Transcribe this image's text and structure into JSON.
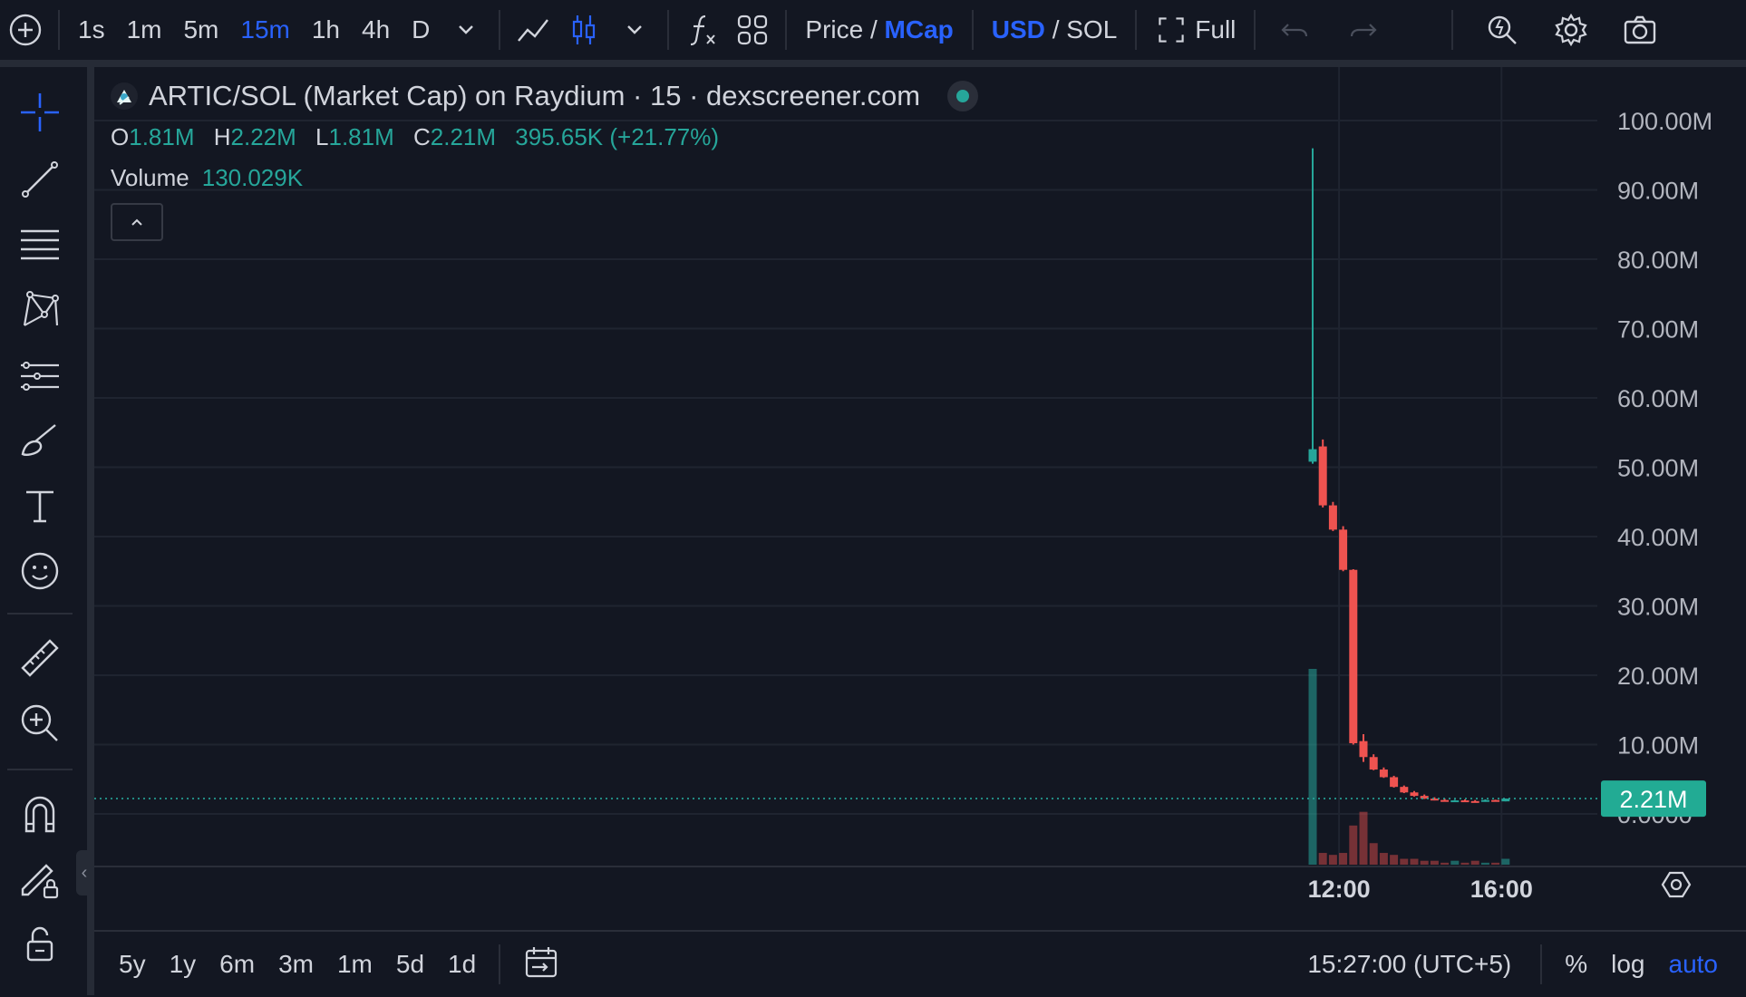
{
  "toolbar": {
    "intervals": [
      "1s",
      "1m",
      "5m",
      "15m",
      "1h",
      "4h",
      "D"
    ],
    "active_interval": "15m",
    "price_label": "Price",
    "mcap_label": "MCap",
    "usd_label": "USD",
    "sol_label": "SOL",
    "full_label": "Full",
    "separator": "/"
  },
  "legend": {
    "title": "ARTIC/SOL (Market Cap) on Raydium · 15 · dexscreener.com",
    "o_label": "O",
    "o_value": "1.81M",
    "h_label": "H",
    "h_value": "2.22M",
    "l_label": "L",
    "l_value": "1.81M",
    "c_label": "C",
    "c_value": "2.21M",
    "change": "395.65K (+21.77%)",
    "volume_label": "Volume",
    "volume_value": "130.029K"
  },
  "bottom": {
    "ranges": [
      "5y",
      "1y",
      "6m",
      "3m",
      "1m",
      "5d",
      "1d"
    ],
    "time": "15:27:00 (UTC+5)",
    "percent_label": "%",
    "log_label": "log",
    "auto_label": "auto"
  },
  "colors": {
    "background": "#131722",
    "up": "#26a69a",
    "down": "#ef5350",
    "accent": "#2962ff",
    "grid": "#1f2430",
    "text": "#d1d4dc"
  },
  "chart_data": {
    "type": "candlestick",
    "interval": "15m",
    "y_ticks": [
      "100.00M",
      "90.00M",
      "80.00M",
      "70.00M",
      "60.00M",
      "50.00M",
      "40.00M",
      "30.00M",
      "20.00M",
      "10.00M",
      "0.0000"
    ],
    "ylim": [
      0,
      100000000
    ],
    "x_ticks": [
      {
        "label": "12:00",
        "index": 2.6
      },
      {
        "label": "16:00",
        "index": 18.6
      }
    ],
    "last_price": 2210000,
    "last_price_label": "2.21M",
    "candles": [
      {
        "o": 50800000,
        "h": 96000000,
        "l": 50500000,
        "c": 52600000,
        "v": 100
      },
      {
        "o": 53000000,
        "h": 54000000,
        "l": 44200000,
        "c": 44500000,
        "v": 6
      },
      {
        "o": 44500000,
        "h": 45000000,
        "l": 40800000,
        "c": 41000000,
        "v": 5
      },
      {
        "o": 41000000,
        "h": 41500000,
        "l": 35000000,
        "c": 35200000,
        "v": 6
      },
      {
        "o": 35200000,
        "h": 35300000,
        "l": 10000000,
        "c": 10200000,
        "v": 20
      },
      {
        "o": 10500000,
        "h": 11500000,
        "l": 7500000,
        "c": 8200000,
        "v": 27
      },
      {
        "o": 8200000,
        "h": 8600000,
        "l": 6300000,
        "c": 6400000,
        "v": 11
      },
      {
        "o": 6400000,
        "h": 6700000,
        "l": 5200000,
        "c": 5300000,
        "v": 6
      },
      {
        "o": 5300000,
        "h": 5500000,
        "l": 3800000,
        "c": 3900000,
        "v": 5
      },
      {
        "o": 3900000,
        "h": 4100000,
        "l": 3000000,
        "c": 3100000,
        "v": 3
      },
      {
        "o": 3100000,
        "h": 3300000,
        "l": 2500000,
        "c": 2600000,
        "v": 3
      },
      {
        "o": 2600000,
        "h": 2800000,
        "l": 2150000,
        "c": 2200000,
        "v": 2
      },
      {
        "o": 2200000,
        "h": 2400000,
        "l": 1950000,
        "c": 2000000,
        "v": 2
      },
      {
        "o": 2000000,
        "h": 2200000,
        "l": 1820000,
        "c": 1850000,
        "v": 1
      },
      {
        "o": 1850000,
        "h": 2050000,
        "l": 1750000,
        "c": 1950000,
        "v": 2
      },
      {
        "o": 1950000,
        "h": 2100000,
        "l": 1800000,
        "c": 1850000,
        "v": 1
      },
      {
        "o": 1850000,
        "h": 2000000,
        "l": 1780000,
        "c": 1800000,
        "v": 2
      },
      {
        "o": 1800000,
        "h": 2100000,
        "l": 1750000,
        "c": 2000000,
        "v": 1
      },
      {
        "o": 2000000,
        "h": 2050000,
        "l": 1800000,
        "c": 1820000,
        "v": 1
      },
      {
        "o": 1810000,
        "h": 2220000,
        "l": 1810000,
        "c": 2210000,
        "v": 3
      }
    ]
  }
}
